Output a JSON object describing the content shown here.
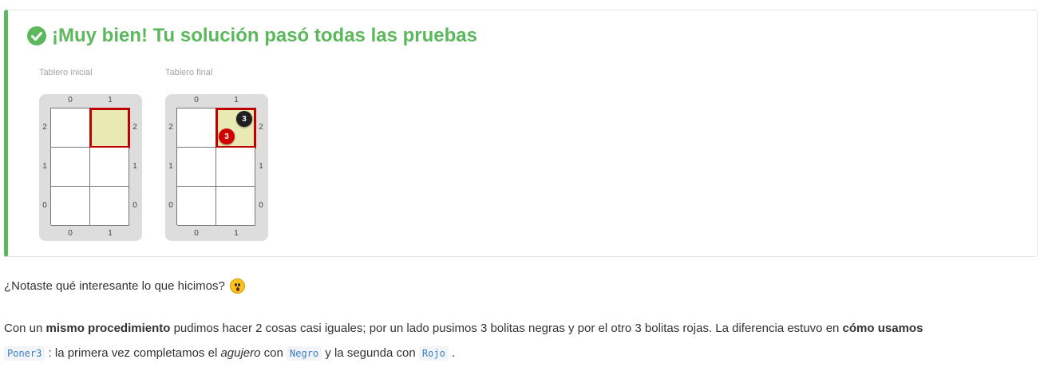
{
  "result": {
    "title": "¡Muy bien! Tu solución pasó todas las pruebas",
    "status_color": "#5cb85c"
  },
  "boards": [
    {
      "caption": "Tablero inicial",
      "col_labels": [
        "0",
        "1"
      ],
      "row_labels": [
        "2",
        "1",
        "0"
      ],
      "selected_cell": {
        "column": 1,
        "row": 2
      },
      "balls": []
    },
    {
      "caption": "Tablero final",
      "col_labels": [
        "0",
        "1"
      ],
      "row_labels": [
        "2",
        "1",
        "0"
      ],
      "selected_cell": {
        "column": 1,
        "row": 2
      },
      "balls": [
        {
          "color": "black",
          "count": "3"
        },
        {
          "color": "red",
          "count": "3"
        }
      ]
    }
  ],
  "question": {
    "text": "¿Notaste qué interesante lo que hicimos?",
    "emoji": "hushed-face-emoji"
  },
  "paragraph": {
    "t1": "Con un ",
    "b1": "mismo procedimiento",
    "t2": " pudimos hacer 2 cosas casi iguales; por un lado pusimos 3 bolitas negras y por el otro 3 bolitas rojas. La diferencia estuvo en ",
    "b2": "cómo usamos",
    "code1": "Poner3",
    "t3": " : la primera vez completamos el ",
    "i1": "agujero",
    "t4": " con ",
    "code2": "Negro",
    "t5": " y la segunda con ",
    "code3": "Rojo",
    "t6": " ."
  }
}
